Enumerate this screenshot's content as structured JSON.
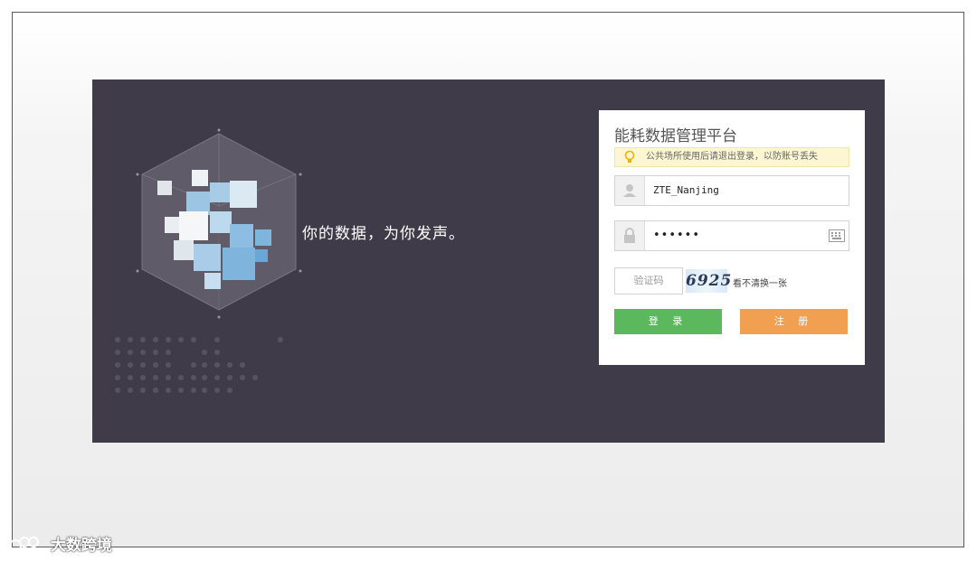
{
  "slogan": "你的数据，为你发声。",
  "login": {
    "title": "能耗数据管理平台",
    "notice": "公共场所使用后请退出登录，以防账号丢失",
    "username": "ZTE_Nanjing",
    "password_mask": "••••••",
    "captcha_placeholder": "验证码",
    "captcha_code": "6925",
    "refresh_text": "看不清换一张",
    "login_button": "登 录",
    "register_button": "注 册"
  },
  "watermark": "大数跨境",
  "icons": {
    "notice": "lightbulb-icon",
    "user": "user-icon",
    "password": "lock-icon",
    "keyboard": "keyboard-icon",
    "logo": "cube-logo-icon"
  },
  "colors": {
    "panel_bg": "#3f3b49",
    "login_button": "#5cb85c",
    "register_button": "#f0a050",
    "notice_bg": "#fdf6d2",
    "cube_accent": "#7fb4dc"
  }
}
